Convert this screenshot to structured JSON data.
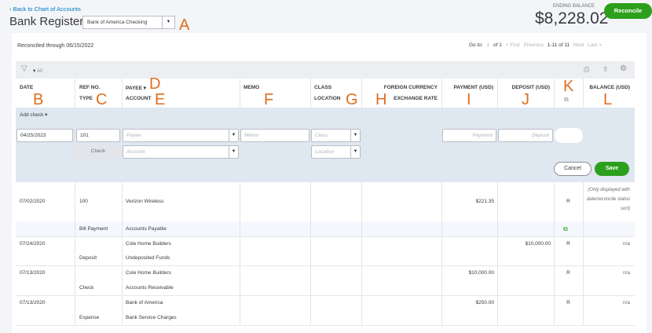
{
  "header": {
    "back_link": "Back to Chart of Accounts",
    "title": "Bank Register",
    "account": "Bank of America Checking",
    "ending_balance_label": "ENDING BALANCE",
    "ending_balance": "$8,228.02",
    "reconcile": "Reconcile"
  },
  "reconciled": "Reconciled through 06/15/2022",
  "pager": {
    "goto": "Go to:",
    "page": "1",
    "of": "of 1",
    "first": "< First",
    "previous": "Previous",
    "range": "1-11 of 11",
    "next": "Next",
    "last": "Last >"
  },
  "filter": {
    "label": "All"
  },
  "columns": {
    "date": "DATE",
    "ref": "REF NO.",
    "type": "TYPE",
    "payee": "PAYEE",
    "account": "ACCOUNT",
    "memo": "MEMO",
    "class": "CLASS",
    "location": "LOCATION",
    "foreign_currency": "FOREIGN CURRENCY",
    "exchange_rate": "EXCHANGE RATE",
    "payment": "PAYMENT (USD)",
    "deposit": "DEPOSIT (USD)",
    "balance": "BALANCE (USD)"
  },
  "annotations": {
    "A": "A",
    "B": "B",
    "C": "C",
    "D": "D",
    "E": "E",
    "F": "F",
    "G": "G",
    "H": "H",
    "I": "I",
    "J": "J",
    "K": "K",
    "L": "L"
  },
  "add_check": "Add check",
  "edit": {
    "date": "04/25/2023",
    "ref": "101",
    "payee_ph": "Payee",
    "memo_ph": "Memo",
    "class_ph": "Class",
    "payment_ph": "Payment",
    "deposit_ph": "Deposit",
    "type": "Check",
    "account_ph": "Account",
    "location_ph": "Location",
    "cancel": "Cancel",
    "save": "Save"
  },
  "rows": [
    {
      "date": "07/02/2020",
      "ref": "100",
      "payee": "Verizon Wireless",
      "type": "Bill Payment",
      "account": "Accounts Payable",
      "payment": "$221.35",
      "deposit": "",
      "status": "R",
      "balance": "(Only displayed with date/reconcile status sort)"
    },
    {
      "date": "07/24/2020",
      "ref": "",
      "payee": "Cole Home Builders",
      "type": "Deposit",
      "account": "Undeposited Funds",
      "payment": "",
      "deposit": "$10,000.00",
      "status": "R",
      "balance": "n/a"
    },
    {
      "date": "07/13/2020",
      "ref": "",
      "payee": "Cole Home Builders",
      "type": "Check",
      "account": "Accounts Receivable",
      "payment": "$10,000.00",
      "deposit": "",
      "status": "R",
      "balance": "n/a"
    },
    {
      "date": "07/13/2020",
      "ref": "",
      "payee": "Bank of America",
      "type": "Expense",
      "account": "Bank Service Charges",
      "payment": "$250.00",
      "deposit": "",
      "status": "R",
      "balance": "n/a"
    }
  ]
}
